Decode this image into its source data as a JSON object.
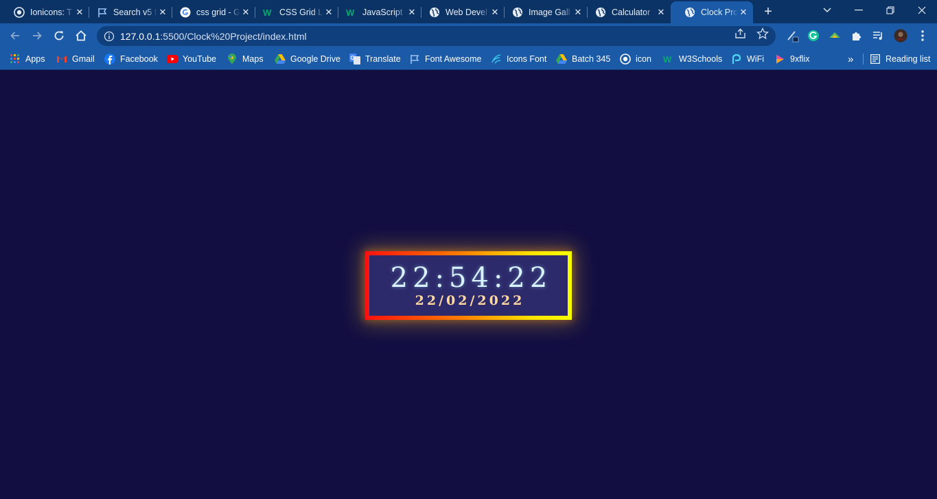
{
  "browser": {
    "tabs": [
      {
        "title": "Ionicons: T",
        "icon": "ionicons-icon",
        "active": false
      },
      {
        "title": "Search v5 I",
        "icon": "flag-icon",
        "active": false
      },
      {
        "title": "css grid - G",
        "icon": "google-icon",
        "active": false
      },
      {
        "title": "CSS Grid L",
        "icon": "w3schools-icon",
        "active": false
      },
      {
        "title": "JavaScript",
        "icon": "w3schools-icon",
        "active": false
      },
      {
        "title": "Web Devel",
        "icon": "globe-icon",
        "active": false
      },
      {
        "title": "Image Gall",
        "icon": "globe-icon",
        "active": false
      },
      {
        "title": "Calculator",
        "icon": "globe-icon",
        "active": false
      },
      {
        "title": "Clock Proj",
        "icon": "globe-icon",
        "active": true
      }
    ],
    "tab_close_glyph": "✕",
    "new_tab_glyph": "+",
    "address": {
      "host": "127.0.0.1",
      "path": ":5500/Clock%20Project/index.html"
    },
    "bookmarks": [
      {
        "label": "Apps",
        "icon": "apps-grid-icon"
      },
      {
        "label": "Gmail",
        "icon": "gmail-icon"
      },
      {
        "label": "Facebook",
        "icon": "facebook-icon"
      },
      {
        "label": "YouTube",
        "icon": "youtube-icon"
      },
      {
        "label": "Maps",
        "icon": "maps-icon"
      },
      {
        "label": "Google Drive",
        "icon": "google-drive-icon"
      },
      {
        "label": "Translate",
        "icon": "translate-icon"
      },
      {
        "label": "Font Awesome",
        "icon": "flag-icon"
      },
      {
        "label": "Icons Font",
        "icon": "icons-font-icon"
      },
      {
        "label": "Batch 345",
        "icon": "google-drive-icon"
      },
      {
        "label": "icon",
        "icon": "ionicons-icon"
      },
      {
        "label": "W3Schools",
        "icon": "w3schools-icon"
      },
      {
        "label": "WiFi",
        "icon": "wifi-icon"
      },
      {
        "label": "9xflix",
        "icon": "play-icon"
      }
    ],
    "bookmarks_overflow_glyph": "»",
    "reading_list_label": "Reading list"
  },
  "clock": {
    "time": "22:54:22",
    "date": "22/02/2022"
  },
  "colors": {
    "page_background": "#120e42",
    "clock_background": "#2d2a6b",
    "frame_gradient_start": "#ff1010",
    "frame_gradient_end": "#f4ff00",
    "time_text": "#d7f3ff",
    "date_text": "#ffd9a0"
  }
}
